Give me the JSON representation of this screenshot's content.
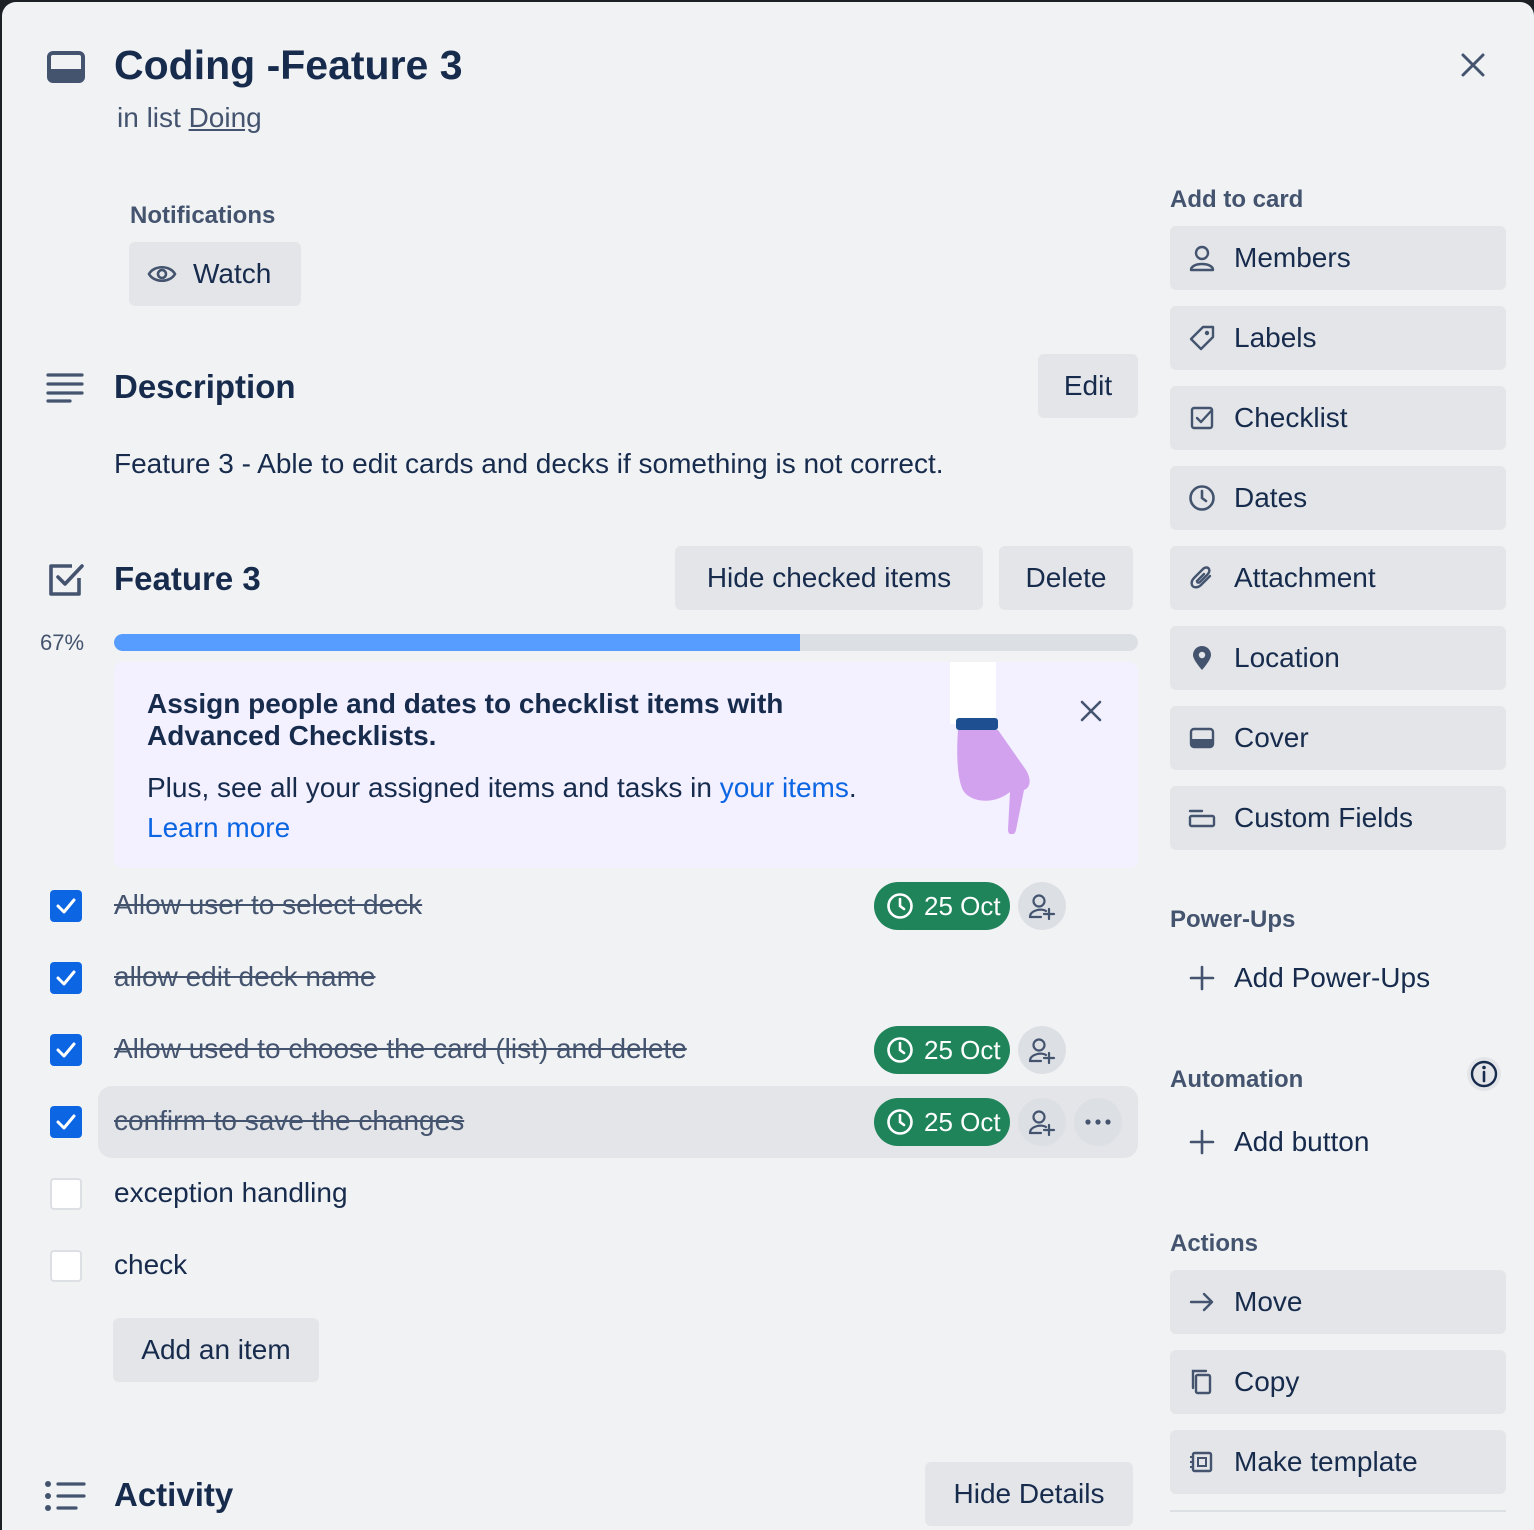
{
  "card": {
    "title": "Coding -Feature 3",
    "in_list_prefix": "in list",
    "list_name": "Doing"
  },
  "notifications": {
    "heading": "Notifications",
    "watch_label": "Watch"
  },
  "description": {
    "heading": "Description",
    "edit_label": "Edit",
    "text": "Feature 3 - Able to edit cards and decks if something is not correct."
  },
  "checklist": {
    "title": "Feature 3",
    "hide_checked_label": "Hide checked items",
    "delete_label": "Delete",
    "progress_text": "67%",
    "progress_fraction": 0.67,
    "progress_color": "#579dff",
    "promo": {
      "title": "Assign people and dates to checklist items with Advanced Checklists.",
      "body_prefix": "Plus, see all your assigned items and tasks in",
      "your_items_link": "your items",
      "body_suffix": ".",
      "learn_more": "Learn more"
    },
    "items": [
      {
        "text": "Allow user to select deck",
        "checked": true,
        "date": "25 Oct"
      },
      {
        "text": "allow edit deck name",
        "checked": true,
        "date": ""
      },
      {
        "text": "Allow used to choose the card (list) and delete",
        "checked": true,
        "date": "25 Oct"
      },
      {
        "text": "confirm to save the changes",
        "checked": true,
        "date": "25 Oct"
      },
      {
        "text": "exception handling",
        "checked": false,
        "date": ""
      },
      {
        "text": "check",
        "checked": false,
        "date": ""
      }
    ],
    "add_item_label": "Add an item"
  },
  "activity": {
    "heading": "Activity",
    "hide_details_label": "Hide Details"
  },
  "sidebar": {
    "add_to_card_heading": "Add to card",
    "add_to_card": [
      {
        "label": "Members",
        "icon": "person-icon"
      },
      {
        "label": "Labels",
        "icon": "tag-icon"
      },
      {
        "label": "Checklist",
        "icon": "checkbox-icon"
      },
      {
        "label": "Dates",
        "icon": "clock-icon"
      },
      {
        "label": "Attachment",
        "icon": "paperclip-icon"
      },
      {
        "label": "Location",
        "icon": "map-pin-icon"
      },
      {
        "label": "Cover",
        "icon": "card-cover-icon"
      },
      {
        "label": "Custom Fields",
        "icon": "custom-fields-icon"
      }
    ],
    "power_ups_heading": "Power-Ups",
    "add_power_ups": "Add Power-Ups",
    "automation_heading": "Automation",
    "add_button": "Add button",
    "actions_heading": "Actions",
    "actions": [
      {
        "label": "Move",
        "icon": "arrow-right-icon"
      },
      {
        "label": "Copy",
        "icon": "copy-icon"
      },
      {
        "label": "Make template",
        "icon": "template-icon"
      }
    ]
  },
  "colors": {
    "modal_bg": "#f1f2f4",
    "button_bg": "#e3e5e8",
    "checked_blue": "#0c66e4",
    "date_green": "#1f845a",
    "link_blue": "#0c66e4",
    "promo_bg": "#f3f0ff"
  }
}
